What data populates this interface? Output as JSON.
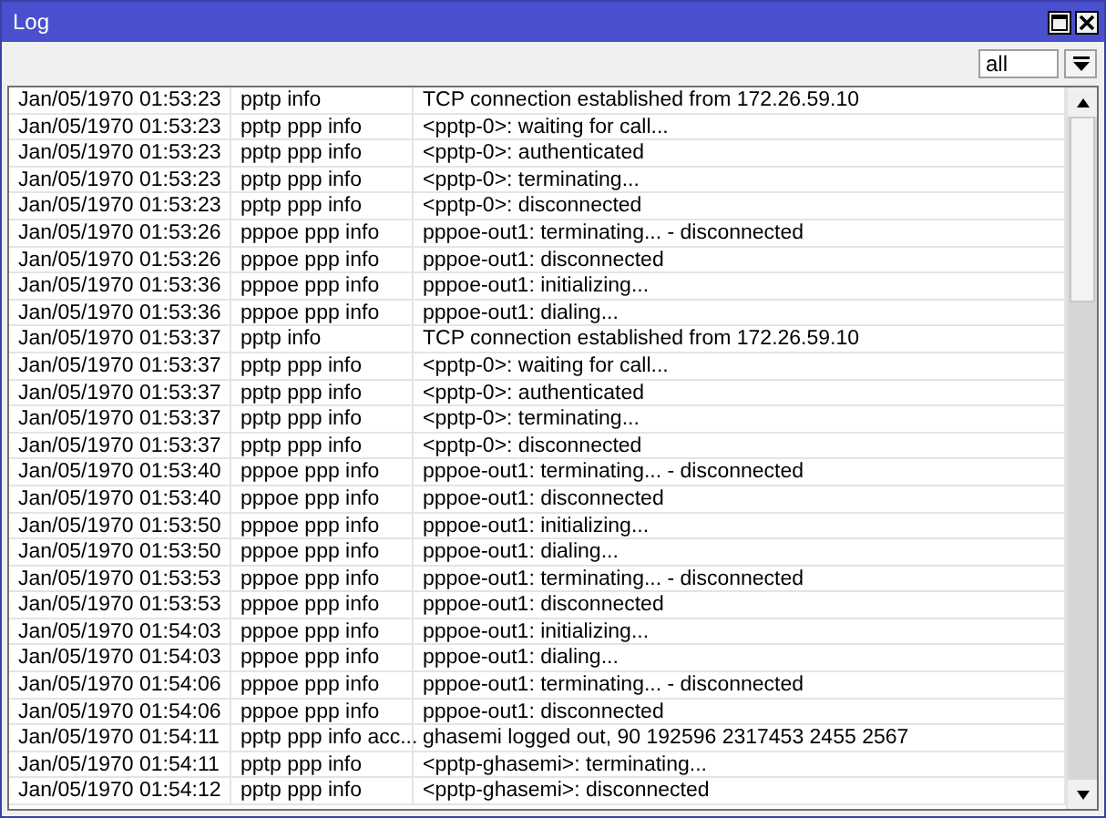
{
  "window": {
    "title": "Log"
  },
  "filter": {
    "value": "all"
  },
  "rows": [
    {
      "time": "Jan/05/1970 01:53:23",
      "topics": "pptp info",
      "message": "TCP connection established from 172.26.59.10"
    },
    {
      "time": "Jan/05/1970 01:53:23",
      "topics": "pptp ppp info",
      "message": "<pptp-0>: waiting for call..."
    },
    {
      "time": "Jan/05/1970 01:53:23",
      "topics": "pptp ppp info",
      "message": "<pptp-0>: authenticated"
    },
    {
      "time": "Jan/05/1970 01:53:23",
      "topics": "pptp ppp info",
      "message": "<pptp-0>: terminating..."
    },
    {
      "time": "Jan/05/1970 01:53:23",
      "topics": "pptp ppp info",
      "message": "<pptp-0>: disconnected"
    },
    {
      "time": "Jan/05/1970 01:53:26",
      "topics": "pppoe ppp info",
      "message": "pppoe-out1: terminating... - disconnected"
    },
    {
      "time": "Jan/05/1970 01:53:26",
      "topics": "pppoe ppp info",
      "message": "pppoe-out1: disconnected"
    },
    {
      "time": "Jan/05/1970 01:53:36",
      "topics": "pppoe ppp info",
      "message": "pppoe-out1: initializing..."
    },
    {
      "time": "Jan/05/1970 01:53:36",
      "topics": "pppoe ppp info",
      "message": "pppoe-out1: dialing..."
    },
    {
      "time": "Jan/05/1970 01:53:37",
      "topics": "pptp info",
      "message": "TCP connection established from 172.26.59.10"
    },
    {
      "time": "Jan/05/1970 01:53:37",
      "topics": "pptp ppp info",
      "message": "<pptp-0>: waiting for call..."
    },
    {
      "time": "Jan/05/1970 01:53:37",
      "topics": "pptp ppp info",
      "message": "<pptp-0>: authenticated"
    },
    {
      "time": "Jan/05/1970 01:53:37",
      "topics": "pptp ppp info",
      "message": "<pptp-0>: terminating..."
    },
    {
      "time": "Jan/05/1970 01:53:37",
      "topics": "pptp ppp info",
      "message": "<pptp-0>: disconnected"
    },
    {
      "time": "Jan/05/1970 01:53:40",
      "topics": "pppoe ppp info",
      "message": "pppoe-out1: terminating... - disconnected"
    },
    {
      "time": "Jan/05/1970 01:53:40",
      "topics": "pppoe ppp info",
      "message": "pppoe-out1: disconnected"
    },
    {
      "time": "Jan/05/1970 01:53:50",
      "topics": "pppoe ppp info",
      "message": "pppoe-out1: initializing..."
    },
    {
      "time": "Jan/05/1970 01:53:50",
      "topics": "pppoe ppp info",
      "message": "pppoe-out1: dialing..."
    },
    {
      "time": "Jan/05/1970 01:53:53",
      "topics": "pppoe ppp info",
      "message": "pppoe-out1: terminating... - disconnected"
    },
    {
      "time": "Jan/05/1970 01:53:53",
      "topics": "pppoe ppp info",
      "message": "pppoe-out1: disconnected"
    },
    {
      "time": "Jan/05/1970 01:54:03",
      "topics": "pppoe ppp info",
      "message": "pppoe-out1: initializing..."
    },
    {
      "time": "Jan/05/1970 01:54:03",
      "topics": "pppoe ppp info",
      "message": "pppoe-out1: dialing..."
    },
    {
      "time": "Jan/05/1970 01:54:06",
      "topics": "pppoe ppp info",
      "message": "pppoe-out1: terminating... - disconnected"
    },
    {
      "time": "Jan/05/1970 01:54:06",
      "topics": "pppoe ppp info",
      "message": "pppoe-out1: disconnected"
    },
    {
      "time": "Jan/05/1970 01:54:11",
      "topics": "pptp ppp info acc...",
      "message": "ghasemi logged out, 90 192596 2317453 2455 2567"
    },
    {
      "time": "Jan/05/1970 01:54:11",
      "topics": "pptp ppp info",
      "message": "<pptp-ghasemi>: terminating..."
    },
    {
      "time": "Jan/05/1970 01:54:12",
      "topics": "pptp ppp info",
      "message": "<pptp-ghasemi>: disconnected"
    }
  ]
}
